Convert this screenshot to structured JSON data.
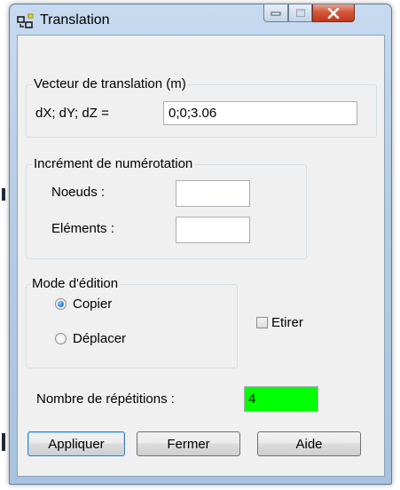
{
  "window": {
    "title": "Translation"
  },
  "colors": {
    "repetitions_field_bg": "#00ff00",
    "close_button": "#c7391c"
  },
  "translation_vector": {
    "legend": "Vecteur de translation (m)",
    "label": "dX; dY; dZ  =",
    "value": "0;0;3.06"
  },
  "numbering_increment": {
    "legend": "Incrément de numérotation",
    "nodes_label": "Noeuds :",
    "nodes_value": "",
    "elements_label": "Eléments :",
    "elements_value": ""
  },
  "edit_mode": {
    "legend": "Mode d'édition",
    "options": [
      {
        "label": "Copier",
        "selected": true
      },
      {
        "label": "Déplacer",
        "selected": false
      }
    ]
  },
  "stretch": {
    "label": "Etirer",
    "checked": false
  },
  "repetitions": {
    "label": "Nombre de répétitions :",
    "value": "4"
  },
  "buttons": {
    "apply": "Appliquer",
    "close": "Fermer",
    "help": "Aide"
  }
}
